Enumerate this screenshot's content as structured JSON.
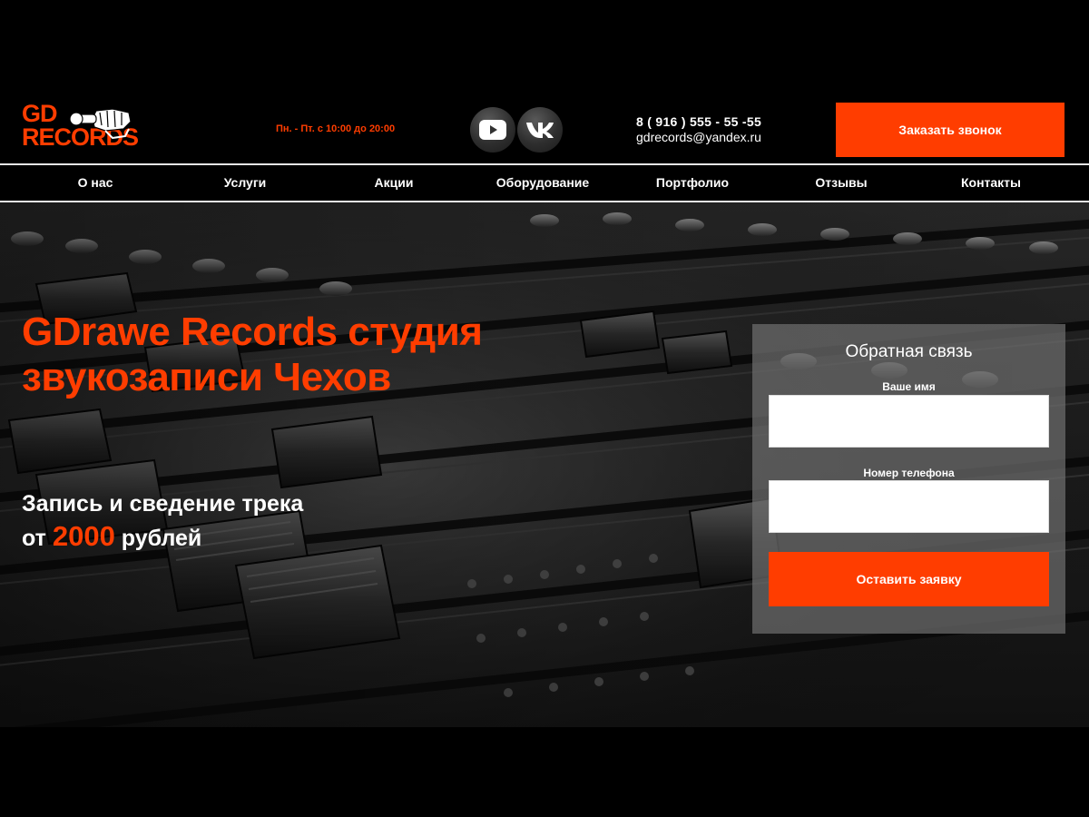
{
  "header": {
    "logo": {
      "line1": "GD",
      "line2": "RECORDS"
    },
    "hours": "Пн. - Пт. с 10:00 до 20:00",
    "social": [
      {
        "name": "youtube",
        "icon": "youtube-icon"
      },
      {
        "name": "vk",
        "icon": "vk-icon"
      }
    ],
    "phone": "8 ( 916 ) 555 - 55 -55",
    "email": "gdrecords@yandex.ru",
    "call_button": "Заказать звонок"
  },
  "nav": {
    "items": [
      "О нас",
      "Услуги",
      "Акции",
      "Оборудование",
      "Портфолио",
      "Отзывы",
      "Контакты"
    ]
  },
  "hero": {
    "title": "GDrawe Records студия звукозаписи Чехов",
    "subtitle_line1": "Запись и сведение трека",
    "subtitle_prefix": "от",
    "price": "2000",
    "subtitle_suffix": "рублей"
  },
  "form": {
    "title": "Обратная связь",
    "name_label": "Ваше имя",
    "name_value": "",
    "phone_label": "Номер телефона",
    "phone_value": "",
    "submit": "Оставить заявку"
  },
  "colors": {
    "accent": "#ff3d00",
    "background": "#000000",
    "nav_border": "#e6e6e6",
    "form_panel": "#6e6e6e"
  }
}
